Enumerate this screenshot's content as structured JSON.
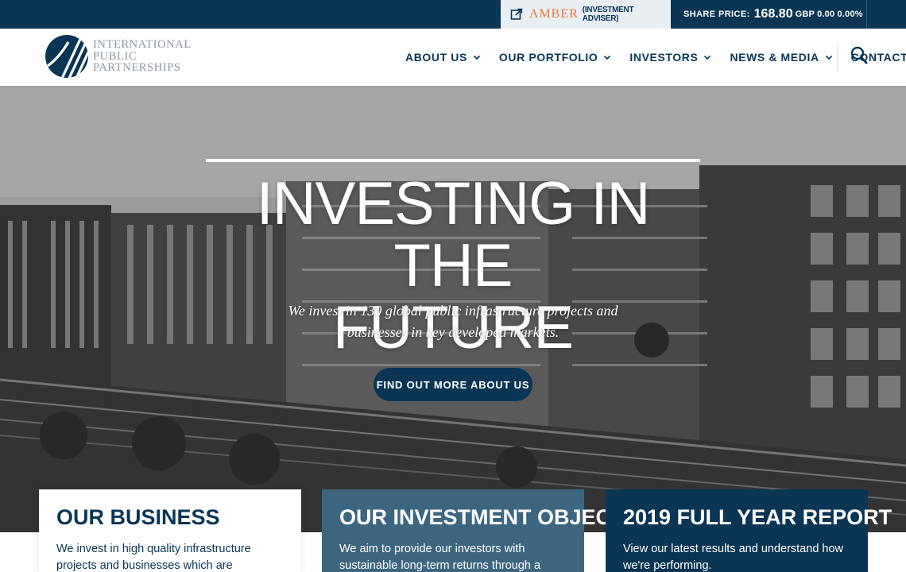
{
  "topbar": {
    "adviser_name": "AMBER",
    "adviser_label": "(INVESTMENT ADVISER)",
    "share_label": "SHARE PRICE:",
    "share_price": "168.80",
    "share_change": "GBP 0.00 0.00%"
  },
  "logo": {
    "line1": "INTERNATIONAL",
    "line2": "PUBLIC",
    "line3": "PARTNERSHIPS"
  },
  "nav": {
    "items": [
      {
        "label": "ABOUT US"
      },
      {
        "label": "OUR PORTFOLIO"
      },
      {
        "label": "INVESTORS"
      },
      {
        "label": "NEWS & MEDIA"
      },
      {
        "label": "CONTACTS"
      }
    ]
  },
  "hero": {
    "title_line1": "INVESTING IN THE",
    "title_line2": "FUTURE",
    "subtitle_line1": "We invest in 130 global public infrastructure projects and",
    "subtitle_line2": "businesses in key developed markets.",
    "button_label": "FIND OUT MORE ABOUT US"
  },
  "cards": [
    {
      "title": "OUR BUSINESS",
      "text": "We invest in high quality infrastructure projects and businesses which are"
    },
    {
      "title": "OUR INVESTMENT OBJECTIVES",
      "text": "We aim to provide our investors with sustainable long-term returns through a"
    },
    {
      "title": "2019 FULL YEAR REPORT",
      "text": "View our latest results and understand how we're performing."
    }
  ],
  "colors": {
    "navy": "#0a3554",
    "steel_blue": "#3c6680",
    "amber": "#e8743b",
    "topbar_highlight": "#e8eef2"
  },
  "icons": [
    "external-link-icon",
    "chevron-down-icon",
    "search-icon",
    "logo-mark"
  ]
}
